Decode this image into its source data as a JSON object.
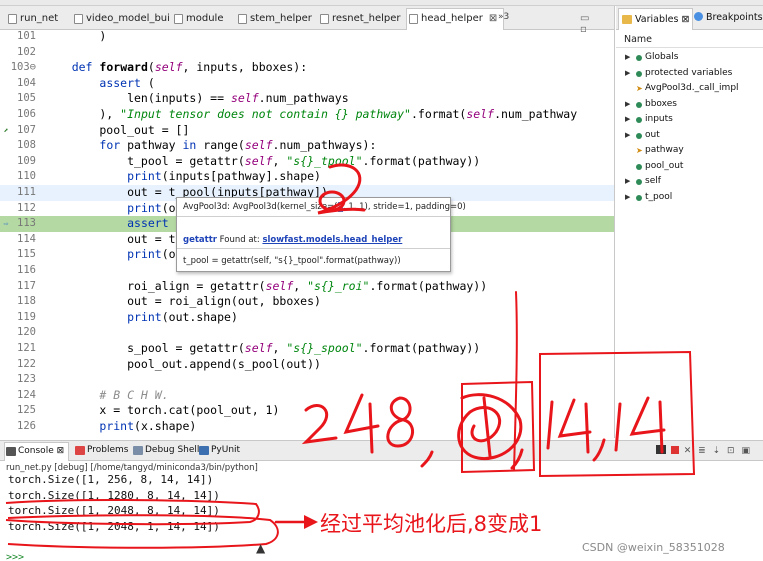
{
  "editor": {
    "tabs": [
      {
        "label": "run_net"
      },
      {
        "label": "video_model_bui"
      },
      {
        "label": "module"
      },
      {
        "label": "stem_helper"
      },
      {
        "label": "resnet_helper"
      },
      {
        "label": "head_helper",
        "close": "⊠"
      }
    ],
    "overflow_count": "»3",
    "window_buttons": "▭ ▫"
  },
  "code_lines": [
    {
      "num": "101",
      "html": "        )"
    },
    {
      "num": "102",
      "html": ""
    },
    {
      "num": "103⊖",
      "html": "    <span class=\"kw\">def</span> <span class=\"fn\">forward</span>(<span class=\"self\">self</span>, inputs, bboxes):"
    },
    {
      "num": "104",
      "html": "        <span class=\"kw\">assert</span> ("
    },
    {
      "num": "105",
      "html": "            len(inputs) == <span class=\"self\">self</span>.num_pathways"
    },
    {
      "num": "106",
      "html": "        ), <span class=\"str\">\"Input tensor does not contain {} pathway\"</span>.format(<span class=\"self\">self</span>.num_pathway"
    },
    {
      "num": "107",
      "html": "        pool_out = []"
    },
    {
      "num": "108",
      "html": "        <span class=\"kw\">for</span> pathway <span class=\"kw\">in</span> range(<span class=\"self\">self</span>.num_pathways):"
    },
    {
      "num": "109",
      "html": "            t_pool = getattr(<span class=\"self\">self</span>, <span class=\"str\">\"s{}_tpool\"</span>.format(pathway))"
    },
    {
      "num": "110",
      "html": "            <span class=\"kw\">print</span>(inputs[pathway].shape)"
    },
    {
      "num": "111",
      "html": "            out = t_pool(inputs[pathway])"
    },
    {
      "num": "112",
      "html": "            <span class=\"kw\">print</span>(o"
    },
    {
      "num": "113",
      "html": "            <span class=\"kw\">assert</span>"
    },
    {
      "num": "114",
      "html": "            out = t"
    },
    {
      "num": "115",
      "html": "            <span class=\"kw\">print</span>(o"
    },
    {
      "num": "116",
      "html": ""
    },
    {
      "num": "117",
      "html": "            roi_align = getattr(<span class=\"self\">self</span>, <span class=\"str\">\"s{}_roi\"</span>.format(pathway))"
    },
    {
      "num": "118",
      "html": "            out = roi_align(out, bboxes)"
    },
    {
      "num": "119",
      "html": "            <span class=\"kw\">print</span>(out.shape)"
    },
    {
      "num": "120",
      "html": ""
    },
    {
      "num": "121",
      "html": "            s_pool = getattr(<span class=\"self\">self</span>, <span class=\"str\">\"s{}_spool\"</span>.format(pathway))"
    },
    {
      "num": "122",
      "html": "            pool_out.append(s_pool(out))"
    },
    {
      "num": "123",
      "html": ""
    },
    {
      "num": "124",
      "html": "        <span class=\"cm\"># B C H W.</span>"
    },
    {
      "num": "125",
      "html": "        x = torch.cat(pool_out, 1)"
    },
    {
      "num": "126",
      "html": "        <span class=\"kw\">print</span>(x.shape)"
    }
  ],
  "tooltip": {
    "sig_before": "AvgPool3d: AvgPool3d(kernel_size=(",
    "sig_highlight": "8",
    "sig_after": ", 1, 1), stride=1, padding=0)",
    "found_name": "getattr",
    "found_text": " Found at: ",
    "found_link": "slowfast.models.head_helper",
    "code": "t_pool = getattr(self, \"s{}_tpool\".format(pathway))"
  },
  "variables": {
    "tabs": [
      {
        "label": "Variables",
        "close": "⊠"
      },
      {
        "label": "Breakpoints"
      }
    ],
    "header": "Name",
    "items": [
      {
        "label": "Globals",
        "expandable": true,
        "kind": "dot"
      },
      {
        "label": "protected variables",
        "expandable": true,
        "kind": "dot"
      },
      {
        "label": "AvgPool3d._call_impl",
        "expandable": false,
        "kind": "arrow"
      },
      {
        "label": "bboxes",
        "expandable": true,
        "kind": "dot"
      },
      {
        "label": "inputs",
        "expandable": true,
        "kind": "dot"
      },
      {
        "label": "out",
        "expandable": true,
        "kind": "dot"
      },
      {
        "label": "pathway",
        "expandable": false,
        "kind": "arrow"
      },
      {
        "label": "pool_out",
        "expandable": false,
        "kind": "dot"
      },
      {
        "label": "self",
        "expandable": true,
        "kind": "dot"
      },
      {
        "label": "t_pool",
        "expandable": true,
        "kind": "dot"
      }
    ]
  },
  "console": {
    "tabs": [
      {
        "label": "Console",
        "close": "⊠"
      },
      {
        "label": "Problems"
      },
      {
        "label": "Debug Shell"
      },
      {
        "label": "PyUnit"
      }
    ],
    "path": "run_net.py [debug] [/home/tangyd/miniconda3/bin/python]",
    "lines": [
      "torch.Size([1, 256, 8, 14, 14])",
      "torch.Size([1, 1280, 8, 14, 14])",
      "torch.Size([1, 2048, 8, 14, 14])",
      "torch.Size([1, 2048, 1, 14, 14])"
    ],
    "prompt": ">>>"
  },
  "annotation": {
    "text": "经过平均池化后,8变成1",
    "handwritten": "2048, 1, 14, 14",
    "circled_number": "2"
  },
  "watermark": "CSDN @weixin_58351028",
  "colors": {
    "annotation": "#e8151b",
    "current_line": "#e8f2fe",
    "breakpoint_line": "#b5d9a3"
  }
}
